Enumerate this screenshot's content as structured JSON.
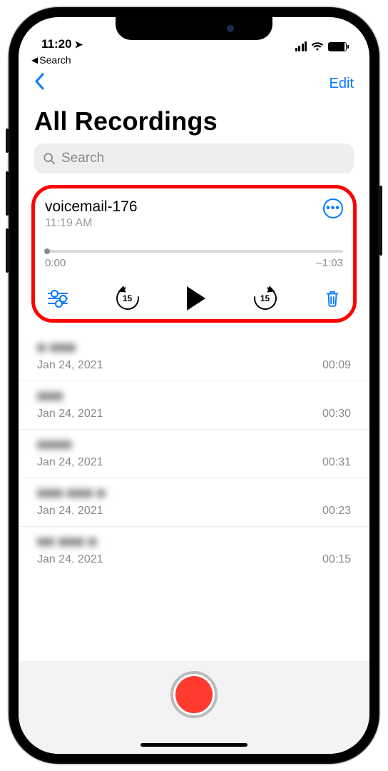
{
  "status": {
    "time": "11:20",
    "breadcrumb": "Search"
  },
  "nav": {
    "edit": "Edit"
  },
  "title": "All Recordings",
  "search": {
    "placeholder": "Search"
  },
  "selected": {
    "title": "voicemail-176",
    "subtitle": "11:19 AM",
    "elapsed": "0:00",
    "remaining": "–1:03",
    "skip_seconds": "15"
  },
  "recordings": [
    {
      "title": "■ ■■■",
      "date": "Jan 24, 2021",
      "duration": "00:09"
    },
    {
      "title": "■■■",
      "date": "Jan 24, 2021",
      "duration": "00:30"
    },
    {
      "title": "■■■■",
      "date": "Jan 24, 2021",
      "duration": "00:31"
    },
    {
      "title": "■■■ ■■■ ■",
      "date": "Jan 24, 2021",
      "duration": "00:23"
    },
    {
      "title": "■■ ■■■ ■",
      "date": "Jan 24. 2021",
      "duration": "00:15"
    }
  ]
}
